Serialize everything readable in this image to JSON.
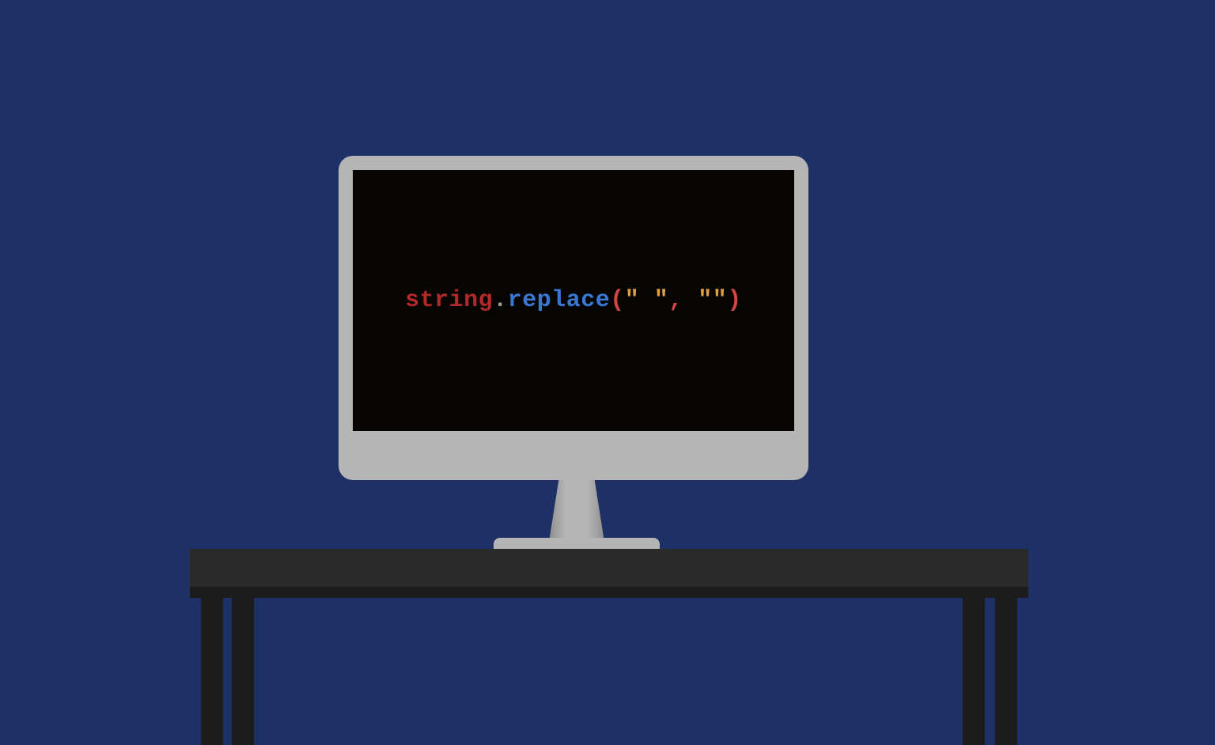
{
  "code": {
    "object": "string",
    "dot": ".",
    "method": "replace",
    "open_paren": "(",
    "arg1": "\" \"",
    "comma": ", ",
    "arg2": "\"\"",
    "close_paren": ")"
  },
  "colors": {
    "background": "#1e3166",
    "screen": "#070502",
    "bezel": "#b5b5b5",
    "desk": "#2a2a2a",
    "object_color": "#b02a2a",
    "method_color": "#3a78d6",
    "punct_color": "#d24545",
    "string_color": "#e0a040"
  }
}
